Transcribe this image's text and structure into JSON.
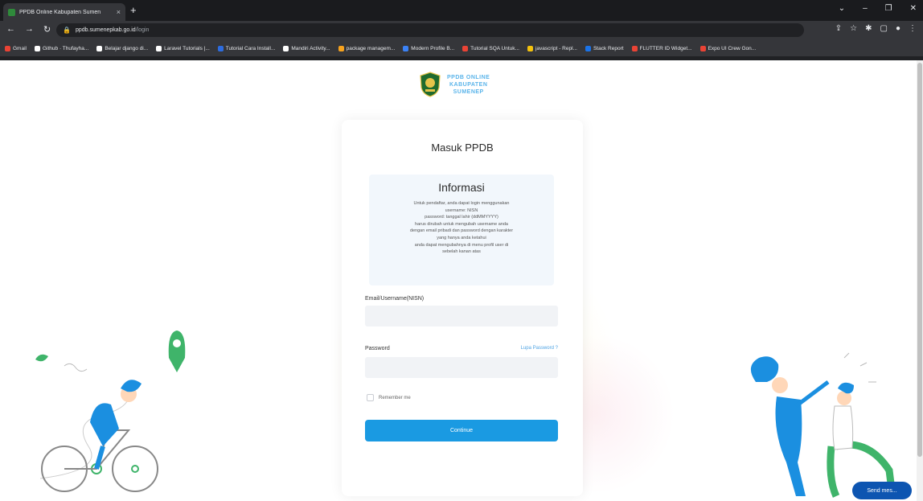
{
  "browser": {
    "tab_title": "PPDB Online Kabupaten Sumen",
    "tab_close": "×",
    "new_tab": "+",
    "url_host": "ppdb.sumenepkab.go.id",
    "url_path": "/login",
    "bookmarks": [
      {
        "label": "Gmail",
        "color": "#ea4335"
      },
      {
        "label": "Github · Thufayha...",
        "color": "#ffffff"
      },
      {
        "label": "Belajar django di...",
        "color": "#ffffff"
      },
      {
        "label": "Laravel Tutorials |...",
        "color": "#ffffff"
      },
      {
        "label": "Tutorial Cara Install...",
        "color": "#2d6cdf"
      },
      {
        "label": "Mandiri Activity...",
        "color": "#ffffff"
      },
      {
        "label": "package managem...",
        "color": "#f6a21e"
      },
      {
        "label": "Modern Profile B...",
        "color": "#3b82f6"
      },
      {
        "label": "Tutorial SQA Untuk...",
        "color": "#ea4335"
      },
      {
        "label": "javascript - Repl...",
        "color": "#f4c20d"
      },
      {
        "label": "Stack Report",
        "color": "#1a73e8"
      },
      {
        "label": "FLUTTER ID Widget...",
        "color": "#ea4335"
      },
      {
        "label": "Expo UI Crew Gon...",
        "color": "#ea4335"
      }
    ]
  },
  "logo": {
    "line1": "PPDB ONLINE",
    "line2": "KABUPATEN",
    "line3": "SUMENEP"
  },
  "login": {
    "title": "Masuk PPDB",
    "info_title": "Informasi",
    "info_lines": [
      "Untuk pendaftar, anda dapat login menggunakan",
      "username: NISN",
      "password: tanggal lahir (ddMMYYYY)",
      "harus dirubah untuk mengubah username anda",
      "dengan email pribadi dan password dengan karakter",
      "yang hanya anda ketahui",
      "anda dapat mengubahnya di menu profil user di",
      "sebelah kanan atas"
    ],
    "email_label": "Email/Username(NISN)",
    "email_value": "",
    "password_label": "Password",
    "password_value": "",
    "forgot_label": "Lupa Password ?",
    "remember_label": "Remember me",
    "continue_label": "Continue"
  },
  "send_button": "Send mes..."
}
